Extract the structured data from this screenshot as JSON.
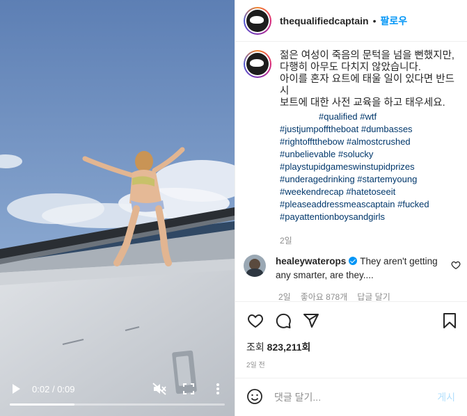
{
  "video": {
    "time_current": "0:02",
    "time_separator": "/",
    "time_total": "0:09",
    "progress_fraction": 0.3
  },
  "header": {
    "username": "thequalifiedcaptain",
    "separator": "•",
    "follow_label": "팔로우"
  },
  "caption": {
    "text": "젊은 여성이 죽음의 문턱을 넘을 뻔했지만,\n다행히 아무도 다치지 않았습니다.\n아이를 혼자 요트에 태울 일이 있다면 반드시\n보트에 대한 사전 교육을 하고 태우세요.",
    "hashtag_lines": [
      "#qualified #wtf",
      "#justjumpofftheboat #dumbasses",
      "#rightofftthebow #almostcrushed",
      "#unbelievable #solucky",
      "#playstupidgameswinstupidprizes",
      "#underagedrinking #startemyoung",
      "#weekendrecap #hatetoseeit",
      "#pleaseaddressmeascaptain #fucked",
      "#payattentionboysandgirls"
    ],
    "time_ago": "2일"
  },
  "comment": {
    "username": "healeywaterops",
    "text": "They aren't getting any smarter, are they....",
    "time_ago": "2일",
    "likes": "좋아요 878개",
    "reply_label": "답글 달기"
  },
  "stats": {
    "views_label": "조회",
    "views_count": "823,211회",
    "date": "2일 전"
  },
  "comment_input": {
    "placeholder": "댓글 달기...",
    "post_label": "게시"
  },
  "icons": [
    "play-icon",
    "mute-icon",
    "fullscreen-icon",
    "more-vertical-icon",
    "heart-icon",
    "comment-icon",
    "share-icon",
    "bookmark-icon",
    "emoji-icon",
    "verified-badge-icon"
  ],
  "colors": {
    "follow_blue": "#0095f6",
    "hashtag_blue": "#00376b",
    "muted_gray": "#8e8e8e",
    "post_disabled": "#b2dffc"
  }
}
